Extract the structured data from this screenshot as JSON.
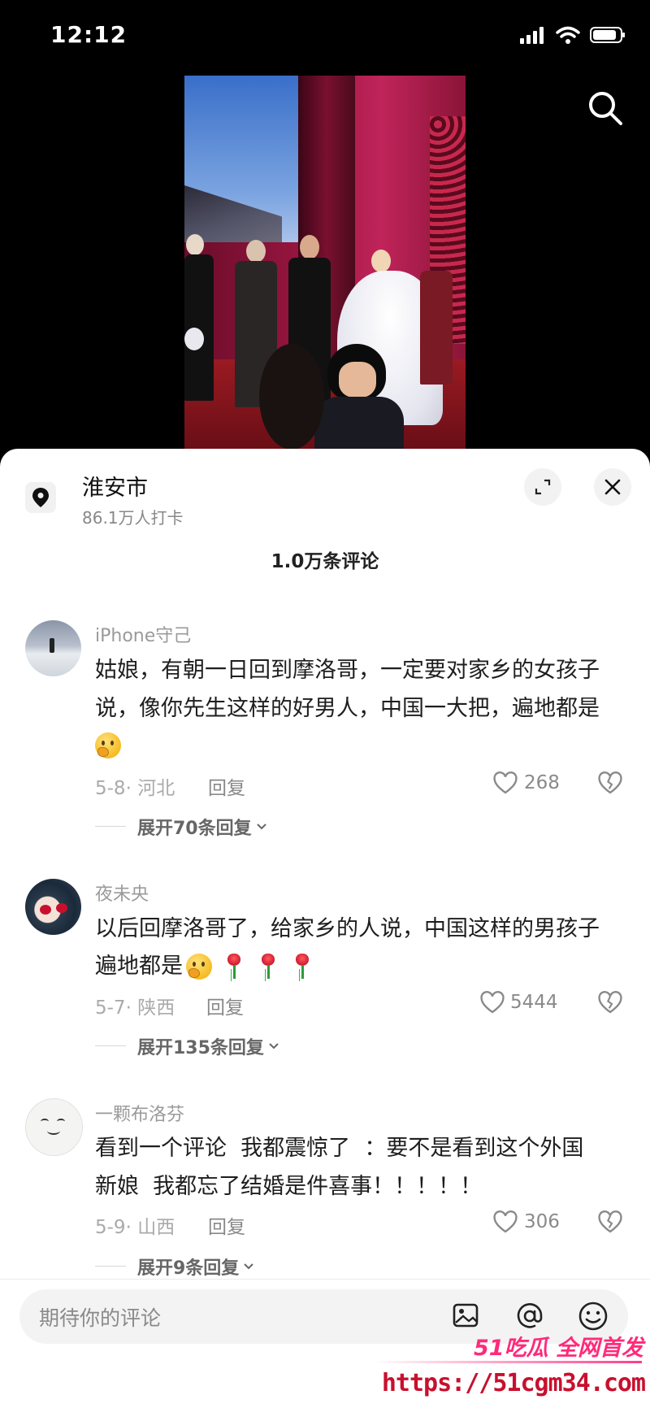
{
  "status_bar": {
    "time": "12:12"
  },
  "location": {
    "name": "淮安市",
    "checkins": "86.1万人打卡"
  },
  "comments_header": {
    "count_label": "1.0万条评论"
  },
  "comments": [
    {
      "username": "iPhone守己",
      "lines": [
        "姑娘，有朝一日回到摩洛哥，一定要对家乡的女孩子",
        "说，像你先生这样的好男人，中国一大把，遍地都是"
      ],
      "emojis": [
        "thinking-face"
      ],
      "date_region": "5-8· 河北",
      "reply_label": "回复",
      "likes": "268",
      "expand_label": "展开70条回复"
    },
    {
      "username": "夜未央",
      "lines": [
        "以后回摩洛哥了，给家乡的人说，中国这样的男孩子",
        "遍地都是"
      ],
      "emojis": [
        "thinking-face",
        "rose",
        "rose",
        "rose"
      ],
      "date_region": "5-7· 陕西",
      "reply_label": "回复",
      "likes": "5444",
      "expand_label": "展开135条回复"
    },
    {
      "username": "一颗布洛芬",
      "lines": [
        "看到一个评论  我都震惊了  ：要不是看到这个外国",
        "新娘  我都忘了结婚是件喜事！！！！！"
      ],
      "emojis": [],
      "date_region": "5-9· 山西",
      "reply_label": "回复",
      "likes": "306",
      "expand_label": "展开9条回复"
    }
  ],
  "input": {
    "placeholder": "期待你的评论"
  },
  "watermark": {
    "brand": "51吃瓜 全网首发",
    "url": "https://51cgm34.com"
  },
  "colors": {
    "background_top": "#000000",
    "sheet": "#ffffff",
    "watermark_pink": "#ff2a7a",
    "watermark_red": "#c8102e"
  },
  "icons": [
    "signal-icon",
    "wifi-icon",
    "battery-icon",
    "search-icon",
    "location-pin-icon",
    "expand-icon",
    "close-icon",
    "heart-icon",
    "dislike-icon",
    "chevron-down-icon",
    "image-icon",
    "at-icon",
    "emoji-icon"
  ]
}
